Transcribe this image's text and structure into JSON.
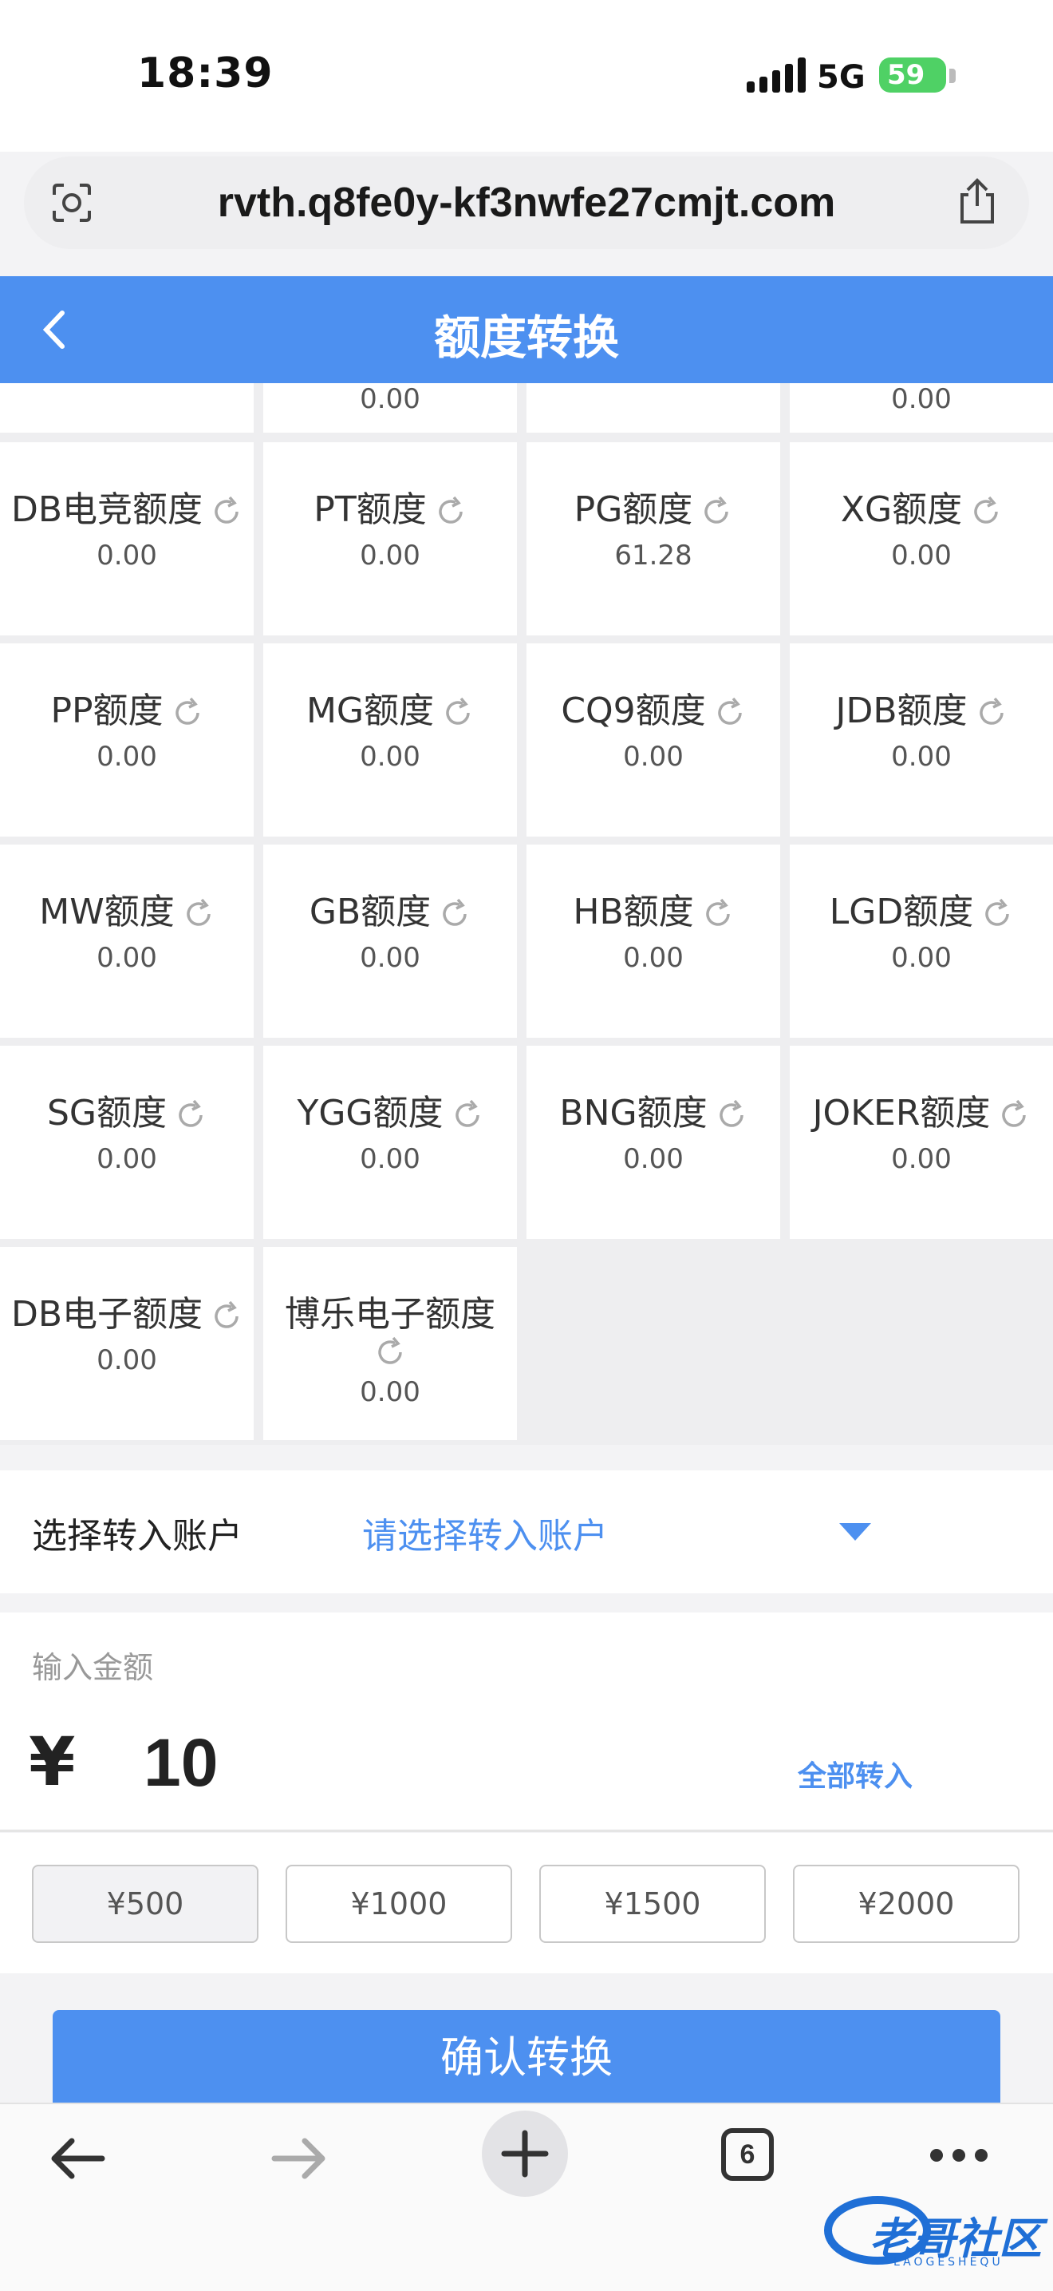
{
  "status": {
    "time": "18:39",
    "network": "5G",
    "battery": "59"
  },
  "browser": {
    "url": "rvth.q8fe0y-kf3nwfe27cmjt.com",
    "tab_count": "6"
  },
  "header": {
    "title": "额度转换"
  },
  "partial_row": [
    "0.00",
    "",
    "0.00"
  ],
  "balances": [
    {
      "label": "DB电竞额度",
      "value": "0.00"
    },
    {
      "label": "PT额度",
      "value": "0.00"
    },
    {
      "label": "PG额度",
      "value": "61.28"
    },
    {
      "label": "XG额度",
      "value": "0.00"
    },
    {
      "label": "PP额度",
      "value": "0.00"
    },
    {
      "label": "MG额度",
      "value": "0.00"
    },
    {
      "label": "CQ9额度",
      "value": "0.00"
    },
    {
      "label": "JDB额度",
      "value": "0.00"
    },
    {
      "label": "MW额度",
      "value": "0.00"
    },
    {
      "label": "GB额度",
      "value": "0.00"
    },
    {
      "label": "HB额度",
      "value": "0.00"
    },
    {
      "label": "LGD额度",
      "value": "0.00"
    },
    {
      "label": "SG额度",
      "value": "0.00"
    },
    {
      "label": "YGG额度",
      "value": "0.00"
    },
    {
      "label": "BNG额度",
      "value": "0.00"
    },
    {
      "label": "JOKER额度",
      "value": "0.00"
    },
    {
      "label": "DB电子额度",
      "value": "0.00"
    },
    {
      "label": "博乐电子额度",
      "value": "0.00"
    }
  ],
  "transfer": {
    "select_label": "选择转入账户",
    "select_placeholder": "请选择转入账户",
    "amount_label": "输入金额",
    "currency": "¥",
    "amount": "10",
    "all_in": "全部转入",
    "quick": [
      "¥500",
      "¥1000",
      "¥1500",
      "¥2000"
    ],
    "confirm": "确认转换"
  },
  "watermark": {
    "text": "老哥社区",
    "sub": "LAOGESHEQU"
  },
  "colors": {
    "primary": "#4d90f0",
    "battery": "#4fd165"
  }
}
